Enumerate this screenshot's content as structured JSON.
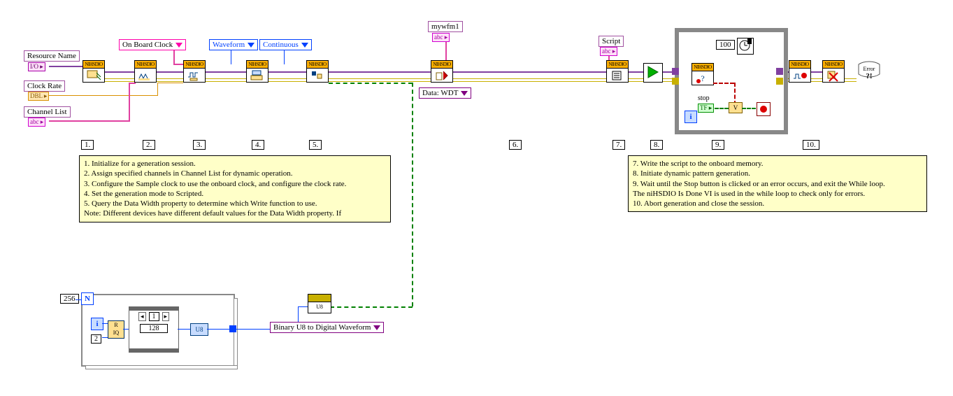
{
  "controls": {
    "resource": {
      "label": "Resource Name",
      "glyph": "I/O"
    },
    "clock": {
      "label": "Clock Rate",
      "glyph": "DBL"
    },
    "channels": {
      "label": "Channel List",
      "glyph": "abc"
    },
    "onboard": {
      "label": "On Board Clock"
    },
    "waveform": {
      "label": "Waveform"
    },
    "continuous": {
      "label": "Continuous"
    },
    "mywfm": {
      "label": "mywfm1",
      "glyph": "abc"
    },
    "datawdt": {
      "label": "Data: WDT"
    },
    "script": {
      "label": "Script",
      "glyph": "abc"
    },
    "stop": {
      "label": "stop",
      "glyph": "TF"
    },
    "n256": "256",
    "wait100": "100",
    "binconv": {
      "label": "Binary U8 to Digital Waveform"
    },
    "q128": "128",
    "qidx": "1",
    "iconst": "2",
    "u8cast": "U8",
    "u8lbl": "U8"
  },
  "nodes": {
    "init": "NIHSDIO",
    "assign": "NIHSDIO",
    "cfgclk": "NIHSDIO",
    "genmode": "NIHSDIO",
    "dataw": "NIHSDIO",
    "write": "NIHSDIO",
    "wscript": "NIHSDIO",
    "initiate": "NIHSDIO",
    "isdone": "NIHSDIO",
    "abort": "NIHSDIO",
    "close": "NIHSDIO",
    "err": "Error"
  },
  "steps": {
    "s1": "1.",
    "s2": "2.",
    "s3": "3.",
    "s4": "4.",
    "s5": "5.",
    "s6": "6.",
    "s7": "7.",
    "s8": "8.",
    "s9": "9.",
    "s10": "10."
  },
  "notes": {
    "left": {
      "l1": "1. Initialize for a generation session.",
      "l2": "2. Assign specified channels in Channel List for dynamic operation.",
      "l3": "3. Configure the Sample clock to use the onboard clock, and configure the clock rate.",
      "l4": "4. Set the generation mode to Scripted.",
      "l5": "5. Query the Data Width property to determine which Write function to use.",
      "l6": "Note: Different devices have different default values for the Data Width property. If"
    },
    "right": {
      "l1": "7. Write the script to the onboard memory.",
      "l2": "8. Initiate dynamic pattern generation.",
      "l3": "9. Wait until the Stop button is clicked or an error occurs, and exit the While loop.",
      "l4": "    The niHSDIO Is Done VI is used in the while loop to check only for errors.",
      "l5": "10. Abort generation and close the session."
    }
  }
}
